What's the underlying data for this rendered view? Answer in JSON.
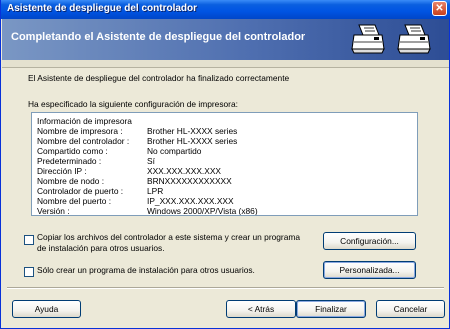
{
  "window": {
    "title": "Asistente de despliegue del controlador",
    "close_glyph": "✕"
  },
  "banner": {
    "heading": "Completando el Asistente de despliegue del controlador",
    "icons": [
      "printer-icon",
      "printer-icon"
    ]
  },
  "status_message": "El Asistente de despliegue del controlador ha finalizado correctamente",
  "config_heading": "Ha especificado la siguiente configuración de impresora:",
  "info": {
    "title": "Información de impresora",
    "rows": [
      {
        "label": "Nombre de impresora :",
        "value": "Brother HL-XXXX series"
      },
      {
        "label": "Nombre del controlador :",
        "value": "Brother HL-XXXX series"
      },
      {
        "label": "Compartido como :",
        "value": "No compartido"
      },
      {
        "label": "Predeterminado :",
        "value": "Sí"
      },
      {
        "label": "Dirección IP :",
        "value": "XXX.XXX.XXX.XXX"
      },
      {
        "label": "Nombre de nodo :",
        "value": "BRNXXXXXXXXXXXX"
      },
      {
        "label": "Controlador de puerto :",
        "value": "LPR"
      },
      {
        "label": "Nombre del puerto :",
        "value": "IP_XXX.XXX.XXX.XXX"
      },
      {
        "label": "Versión :",
        "value": "Windows 2000/XP/Vista (x86)"
      }
    ]
  },
  "options": {
    "copy_files": {
      "label": "Copiar los archivos del controlador a este sistema y crear un programa de instalación para otros usuarios.",
      "checked": false
    },
    "only_installer": {
      "label": "Sólo crear un programa de instalación para otros usuarios.",
      "checked": false
    }
  },
  "buttons": {
    "configuracion": "Configuración...",
    "personalizada": "Personalizada...",
    "ayuda": "Ayuda",
    "atras": "< Atrás",
    "finalizar": "Finalizar",
    "cancelar": "Cancelar"
  },
  "colors": {
    "titlebar": "#0054e3",
    "banner_start": "#7a97c4",
    "banner_end": "#2d4d95",
    "window_bg": "#ece9d8"
  }
}
